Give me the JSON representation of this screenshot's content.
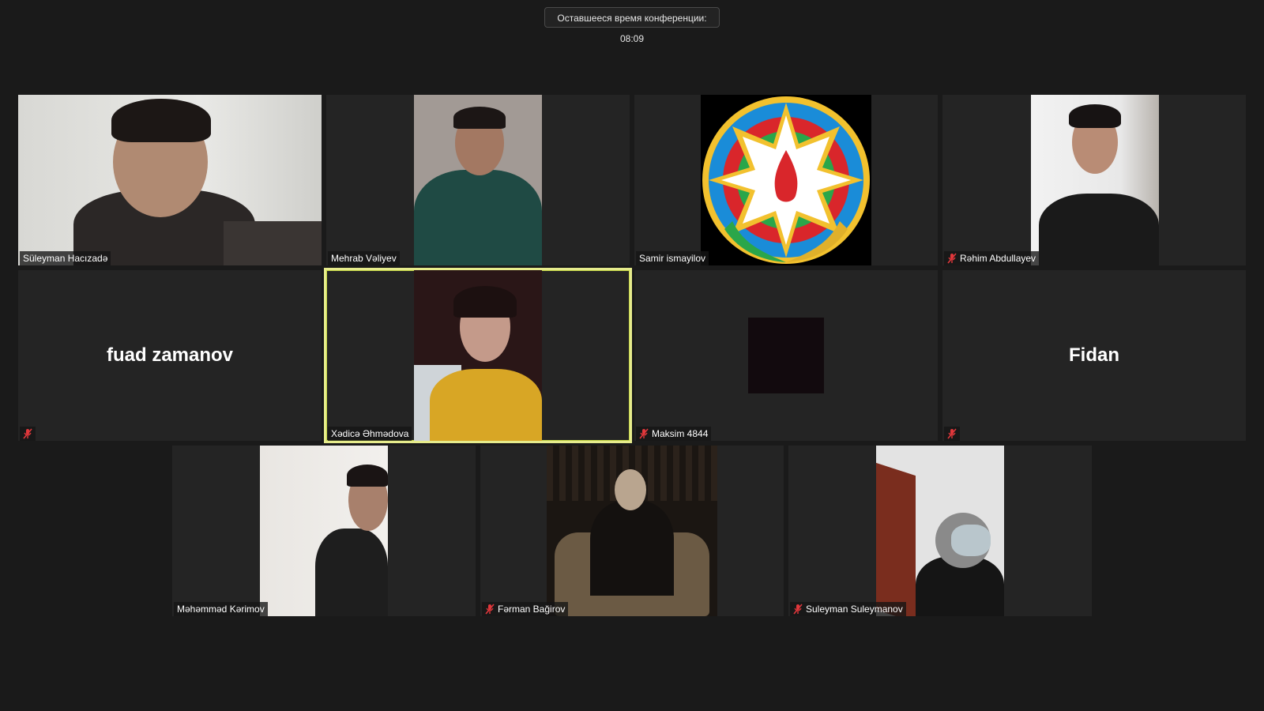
{
  "timer": {
    "text": "Оставшееся время конференции: 08:09"
  },
  "participants": [
    {
      "name": "Süleyman Hacızadə",
      "muted": false
    },
    {
      "name": "Mehrab Vəliyev",
      "muted": false
    },
    {
      "name": "Samir ismayilov",
      "muted": false
    },
    {
      "name": "Rəhim Abdullayev",
      "muted": true
    },
    {
      "name": "fuad zamanov",
      "muted": true,
      "display_text": "fuad zamanov"
    },
    {
      "name": "Xədicə Əhmədova",
      "muted": false,
      "active_speaker": true
    },
    {
      "name": "Maksim 4844",
      "muted": true
    },
    {
      "name": "Fidan",
      "muted": true,
      "display_text": "Fidan"
    },
    {
      "name": "Məhəmməd Kərimov",
      "muted": false
    },
    {
      "name": "Fərman Bağirov",
      "muted": true
    },
    {
      "name": "Suleyman Suleymanov",
      "muted": true
    }
  ],
  "colors": {
    "background": "#1a1a1a",
    "tile": "#242424",
    "active_border": "#e6ec8c",
    "muted_icon": "#e0373b"
  }
}
